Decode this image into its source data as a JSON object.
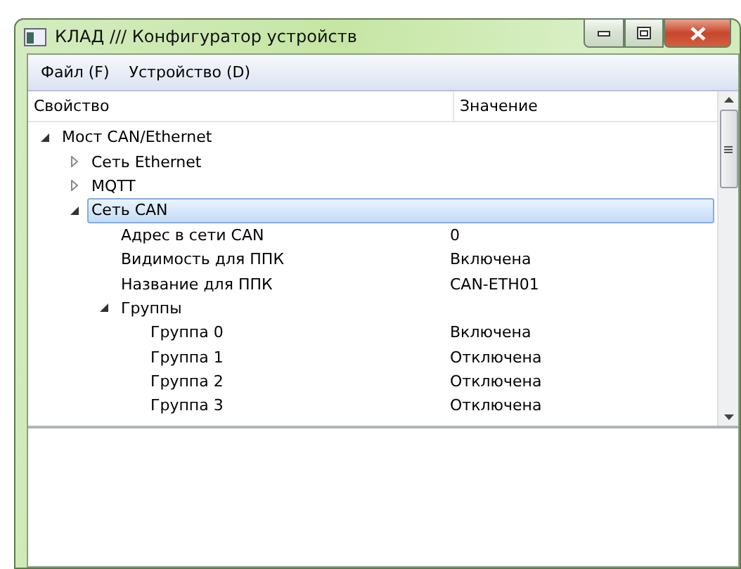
{
  "window": {
    "title": "КЛАД /// Конфигуратор устройств"
  },
  "menu": [
    "Файл (F)",
    "Устройство (D)"
  ],
  "table": {
    "columns": [
      "Свойство",
      "Значение"
    ],
    "rows": [
      {
        "label": "Мост CAN/Ethernet",
        "expanded": true,
        "selected": false,
        "children": [
          {
            "label": "Сеть Ethernet",
            "expanded": false,
            "selected": false
          },
          {
            "label": "MQTT",
            "expanded": false,
            "selected": false
          },
          {
            "label": "Сеть CAN",
            "expanded": true,
            "selected": true,
            "children": [
              {
                "label": "Адрес в сети CAN",
                "value": "0",
                "selected": false
              },
              {
                "label": "Видимость для ППК",
                "value": "Включена",
                "selected": false
              },
              {
                "label": "Название для ППК",
                "value": "CAN-ETH01",
                "selected": false
              },
              {
                "label": "Группы",
                "expanded": true,
                "selected": false,
                "children": [
                  {
                    "label": "Группа 0",
                    "value": "Включена",
                    "selected": false
                  },
                  {
                    "label": "Группа 1",
                    "value": "Отключена",
                    "selected": false
                  },
                  {
                    "label": "Группа 2",
                    "value": "Отключена",
                    "selected": false
                  },
                  {
                    "label": "Группа 3",
                    "value": "Отключена",
                    "selected": false
                  }
                ]
              }
            ]
          }
        ]
      }
    ]
  }
}
